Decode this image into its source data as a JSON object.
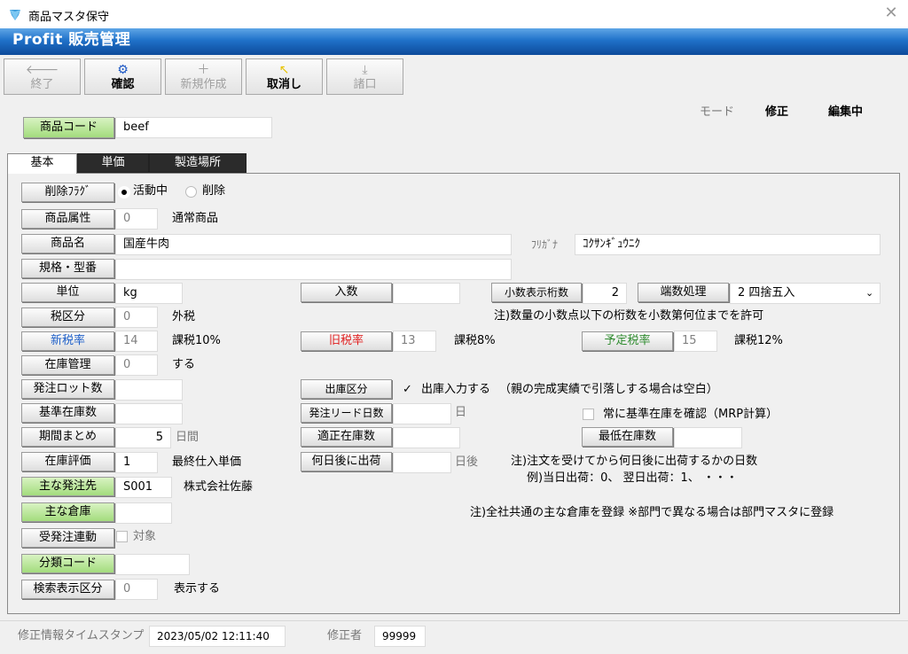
{
  "window": {
    "title": "商品マスタ保守",
    "close_glyph": "✕"
  },
  "banner": {
    "title": "Profit 販売管理"
  },
  "toolbar": [
    {
      "label": "終了",
      "icon": "arrow-left-icon",
      "glyph": "🡐",
      "enabled": false
    },
    {
      "label": "確認",
      "icon": "gear-icon",
      "glyph": "⚙",
      "enabled": true
    },
    {
      "label": "新規作成",
      "icon": "plus-icon",
      "glyph": "＋",
      "enabled": false
    },
    {
      "label": "取消し",
      "icon": "undo-arrow-icon",
      "glyph": "↖",
      "enabled": true
    },
    {
      "label": "諸口",
      "icon": "download-icon",
      "glyph": "⤓",
      "enabled": false
    }
  ],
  "header": {
    "code_label": "商品コード",
    "code_value": "beef",
    "mode_label": "モード",
    "mode_value": "修正",
    "edit_status": "編集中"
  },
  "tabs": [
    "基本",
    "単価",
    "製造場所"
  ],
  "form": {
    "delete_flag": {
      "label": "削除ﾌﾗｸﾞ",
      "active": "活動中",
      "deleted": "削除"
    },
    "attribute": {
      "label": "商品属性",
      "value": "0",
      "desc": "通常商品"
    },
    "name": {
      "label": "商品名",
      "value": "国産牛肉",
      "kana_label": "ﾌﾘｶﾞﾅ",
      "kana_value": "ｺｸｻﾝｷﾞｭｳﾆｸ"
    },
    "spec": {
      "label": "規格・型番",
      "value": ""
    },
    "unit": {
      "label": "単位",
      "value": "kg"
    },
    "irisu": {
      "label": "入数",
      "value": ""
    },
    "decimal": {
      "label": "小数表示桁数",
      "value": "2"
    },
    "rounding": {
      "label": "端数処理",
      "value": "2 四捨五入"
    },
    "decimal_note": "注)数量の小数点以下の桁数を小数第何位までを許可",
    "tax_class": {
      "label": "税区分",
      "value": "0",
      "desc": "外税"
    },
    "new_tax": {
      "label": "新税率",
      "value": "14",
      "desc": "課税10%"
    },
    "old_tax": {
      "label": "旧税率",
      "value": "13",
      "desc": "課税8%"
    },
    "planned_tax": {
      "label": "予定税率",
      "value": "15",
      "desc": "課税12%"
    },
    "stock_mgmt": {
      "label": "在庫管理",
      "value": "0",
      "desc": "する"
    },
    "order_lot": {
      "label": "発注ロット数",
      "value": ""
    },
    "shipping_class": {
      "label": "出庫区分",
      "check_label": "出庫入力する",
      "note": "（親の完成実績で引落しする場合は空白）"
    },
    "base_stock": {
      "label": "基準在庫数",
      "value": ""
    },
    "lead_days": {
      "label": "発注リード日数",
      "value": "",
      "unit": "日"
    },
    "always_base": {
      "label": "常に基準在庫を確認（MRP計算）"
    },
    "period": {
      "label": "期間まとめ",
      "value": "5",
      "unit": "日間"
    },
    "proper_stock": {
      "label": "適正在庫数",
      "value": ""
    },
    "min_stock": {
      "label": "最低在庫数",
      "value": ""
    },
    "valuation": {
      "label": "在庫評価",
      "value": "1",
      "desc": "最終仕入単価"
    },
    "ship_after": {
      "label": "何日後に出荷",
      "value": "",
      "unit": "日後"
    },
    "ship_note1": "注)注文を受けてから何日後に出荷するかの日数",
    "ship_note2": "例)当日出荷：0、 翌日出荷：1、 ・・・",
    "supplier": {
      "label": "主な発注先",
      "value": "S001",
      "desc": "株式会社佐藤"
    },
    "warehouse": {
      "label": "主な倉庫",
      "value": ""
    },
    "warehouse_note": "注)全社共通の主な倉庫を登録 ※部門で異なる場合は部門マスタに登録",
    "order_link": {
      "label": "受発注連動",
      "check_label": "対象"
    },
    "category": {
      "label": "分類コード",
      "value": ""
    },
    "search_disp": {
      "label": "検索表示区分",
      "value": "0",
      "desc": "表示する"
    }
  },
  "status": {
    "stamp_label": "修正情報タイムスタンプ",
    "stamp_value": "2023/05/02 12:11:40",
    "editor_label": "修正者",
    "editor_value": "99999"
  },
  "colors": {
    "new_tax_label": "#1e5fc8",
    "old_tax_label": "#e02020",
    "planned_tax_label": "#2e8b2e"
  }
}
